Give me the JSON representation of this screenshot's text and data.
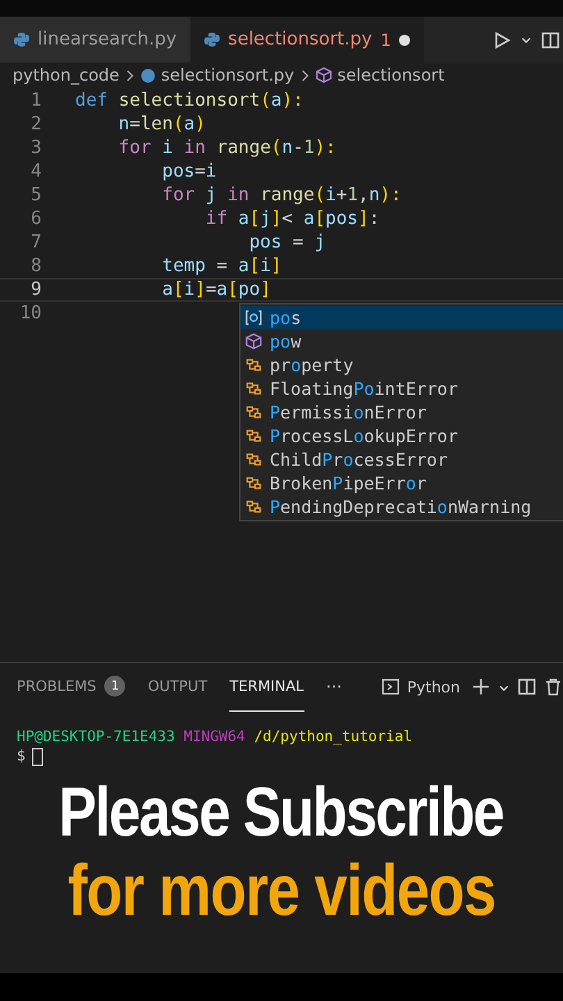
{
  "tabs": [
    {
      "label": "linearsearch.py",
      "selected": false,
      "dirty": false
    },
    {
      "label": "selectionsort.py",
      "selected": true,
      "problems": "1",
      "dirty": true
    }
  ],
  "breadcrumb": {
    "folder": "python_code",
    "file": "selectionsort.py",
    "symbol": "selectionsort"
  },
  "code": [
    {
      "number": "1",
      "current": false,
      "tokens": [
        {
          "text": "def ",
          "kind": "keyword"
        },
        {
          "text": "selectionsort",
          "kind": "function"
        },
        {
          "text": "(",
          "kind": "bracket"
        },
        {
          "text": "a",
          "kind": "variable"
        },
        {
          "text": "):",
          "kind": "bracket"
        }
      ]
    },
    {
      "number": "2",
      "current": false,
      "tokens": [
        {
          "text": "    n",
          "kind": "variable"
        },
        {
          "text": "=",
          "kind": "operator"
        },
        {
          "text": "len",
          "kind": "function"
        },
        {
          "text": "(",
          "kind": "bracket"
        },
        {
          "text": "a",
          "kind": "variable"
        },
        {
          "text": ")",
          "kind": "bracket"
        }
      ]
    },
    {
      "number": "3",
      "current": false,
      "tokens": [
        {
          "text": "    for ",
          "kind": "control"
        },
        {
          "text": "i ",
          "kind": "variable"
        },
        {
          "text": "in ",
          "kind": "control"
        },
        {
          "text": "range",
          "kind": "function"
        },
        {
          "text": "(",
          "kind": "bracket"
        },
        {
          "text": "n",
          "kind": "variable"
        },
        {
          "text": "-",
          "kind": "operator"
        },
        {
          "text": "1",
          "kind": "number"
        },
        {
          "text": "):",
          "kind": "bracket"
        }
      ]
    },
    {
      "number": "4",
      "current": false,
      "tokens": [
        {
          "text": "        pos",
          "kind": "variable"
        },
        {
          "text": "=",
          "kind": "operator"
        },
        {
          "text": "i",
          "kind": "variable"
        }
      ]
    },
    {
      "number": "5",
      "current": false,
      "tokens": [
        {
          "text": "        for ",
          "kind": "control"
        },
        {
          "text": "j ",
          "kind": "variable"
        },
        {
          "text": "in ",
          "kind": "control"
        },
        {
          "text": "range",
          "kind": "function"
        },
        {
          "text": "(",
          "kind": "bracket"
        },
        {
          "text": "i",
          "kind": "variable"
        },
        {
          "text": "+",
          "kind": "operator"
        },
        {
          "text": "1",
          "kind": "number"
        },
        {
          "text": ",",
          "kind": "operator"
        },
        {
          "text": "n",
          "kind": "variable"
        },
        {
          "text": "):",
          "kind": "bracket"
        }
      ]
    },
    {
      "number": "6",
      "current": false,
      "tokens": [
        {
          "text": "            if ",
          "kind": "control"
        },
        {
          "text": "a",
          "kind": "variable"
        },
        {
          "text": "[",
          "kind": "bracket"
        },
        {
          "text": "j",
          "kind": "variable"
        },
        {
          "text": "]",
          "kind": "bracket"
        },
        {
          "text": "< ",
          "kind": "operator"
        },
        {
          "text": "a",
          "kind": "variable"
        },
        {
          "text": "[",
          "kind": "bracket"
        },
        {
          "text": "pos",
          "kind": "variable"
        },
        {
          "text": "]",
          "kind": "bracket"
        },
        {
          "text": ":",
          "kind": "operator"
        }
      ]
    },
    {
      "number": "7",
      "current": false,
      "tokens": [
        {
          "text": "                pos",
          "kind": "variable"
        },
        {
          "text": " = ",
          "kind": "operator"
        },
        {
          "text": "j",
          "kind": "variable"
        }
      ]
    },
    {
      "number": "8",
      "current": false,
      "tokens": [
        {
          "text": "        temp",
          "kind": "variable"
        },
        {
          "text": " = ",
          "kind": "operator"
        },
        {
          "text": "a",
          "kind": "variable"
        },
        {
          "text": "[",
          "kind": "bracket"
        },
        {
          "text": "i",
          "kind": "variable"
        },
        {
          "text": "]",
          "kind": "bracket"
        }
      ]
    },
    {
      "number": "9",
      "current": true,
      "tokens": [
        {
          "text": "        a",
          "kind": "variable"
        },
        {
          "text": "[",
          "kind": "bracket"
        },
        {
          "text": "i",
          "kind": "variable"
        },
        {
          "text": "]",
          "kind": "bracket"
        },
        {
          "text": "=",
          "kind": "operator"
        },
        {
          "text": "a",
          "kind": "variable"
        },
        {
          "text": "[",
          "kind": "bracket"
        },
        {
          "text": "po",
          "kind": "variable"
        },
        {
          "text": "]",
          "kind": "bracket"
        }
      ]
    },
    {
      "number": "10",
      "current": false
    }
  ],
  "suggestions": [
    {
      "kind": "variable",
      "label": "**po**s",
      "selected": true
    },
    {
      "kind": "function",
      "label": "**po**w",
      "selected": false
    },
    {
      "kind": "class",
      "label": "pr**o**perty",
      "selected": false
    },
    {
      "kind": "class",
      "label": "Floating**Po**intError",
      "selected": false
    },
    {
      "kind": "class",
      "label": "**P**ermissi**o**nError",
      "selected": false
    },
    {
      "kind": "class",
      "label": "**P**rocessL**o**okupError",
      "selected": false
    },
    {
      "kind": "class",
      "label": "Child**P**r**o**cessError",
      "selected": false
    },
    {
      "kind": "class",
      "label": "Broken**P**ipeErr**o**r",
      "selected": false
    },
    {
      "kind": "class",
      "label": "**P**endingDeprecati**o**nWarning",
      "selected": false
    }
  ],
  "panel_tabs": [
    {
      "label": "PROBLEMS",
      "badge": "1",
      "selected": false
    },
    {
      "label": "OUTPUT",
      "selected": false
    },
    {
      "label": "TERMINAL",
      "selected": true
    }
  ],
  "panel_more": "···",
  "terminal_profile": "Python",
  "terminal": {
    "user": "HP@DESKTOP-7E1E433",
    "system": "MINGW64",
    "path": "/d/python_tutorial",
    "prompt": "$"
  },
  "caption": {
    "line_1": "Please Subscribe",
    "line_2": "for more videos"
  }
}
